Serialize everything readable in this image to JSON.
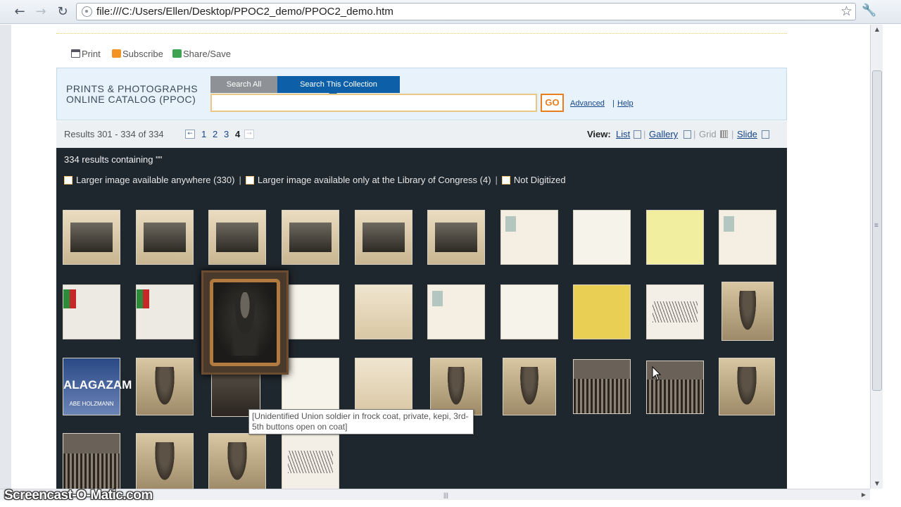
{
  "browser": {
    "url": "file:///C:/Users/Ellen/Desktop/PPOC2_demo/PPOC2_demo.htm",
    "icons": {
      "back": "back-arrow-icon",
      "forward": "forward-arrow-icon",
      "reload": "reload-icon",
      "star": "star-icon",
      "wrench": "wrench-icon"
    }
  },
  "share_links": {
    "print": "Print",
    "subscribe": "Subscribe",
    "share": "Share/Save"
  },
  "header": {
    "catalog_title": "PRINTS & PHOTOGRAPHS ONLINE CATALOG (PPOC)",
    "tab_search_all": "Search All",
    "tab_search_collection": "Search This Collection",
    "search_value": "",
    "go_label": "GO",
    "advanced_label": "Advanced",
    "help_separator": "|",
    "help_label": "Help"
  },
  "results_bar": {
    "count_text": "Results 301 - 334 of 334",
    "pages": [
      "1",
      "2",
      "3",
      "4"
    ],
    "current_page": "4",
    "view_label": "View:",
    "view_list": "List",
    "view_gallery": "Gallery",
    "view_grid": "Grid",
    "view_slide": "Slide",
    "sep": "|"
  },
  "results": {
    "summary": "334 results containing \"\"",
    "filters": [
      "Larger image available anywhere (330)",
      "Larger image available only at the Library of Congress (4)",
      "Not Digitized"
    ],
    "filter_sep": "|",
    "tooltip": "[Unidentified Union soldier in frock coat, private, kepi, 3rd-5th buttons open on coat]",
    "poster_text": [
      "ALAGAZAM",
      "ABE HOLZMANN"
    ]
  },
  "colors": {
    "accent_blue": "#0d60a8",
    "go_orange": "#e87e1e",
    "results_bg": "#1f272e",
    "header_bg": "#e8f2fa"
  },
  "watermark": "Screencast-O-Matic.com"
}
